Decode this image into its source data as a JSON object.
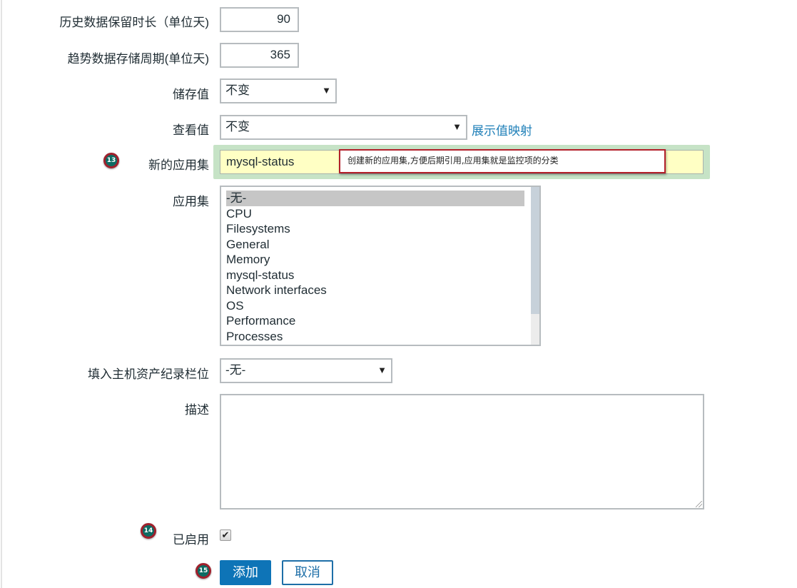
{
  "form": {
    "history": {
      "label": "历史数据保留时长（单位天)",
      "value": "90"
    },
    "trends": {
      "label": "趋势数据存储周期(单位天)",
      "value": "365"
    },
    "store_value": {
      "label": "储存值",
      "selected": "不变"
    },
    "show_value": {
      "label": "查看值",
      "selected": "不变",
      "link": "展示值映射"
    },
    "new_application": {
      "label": "新的应用集",
      "value": "mysql-status",
      "tooltip": "创建新的应用集,方便后期引用,应用集就是监控项的分类"
    },
    "applications": {
      "label": "应用集",
      "options": [
        "-无-",
        "CPU",
        "Filesystems",
        "General",
        "Memory",
        "mysql-status",
        "Network interfaces",
        "OS",
        "Performance",
        "Processes"
      ],
      "selected": "-无-"
    },
    "inventory": {
      "label": "填入主机资产纪录栏位",
      "selected": "-无-"
    },
    "description": {
      "label": "描述",
      "value": ""
    },
    "enabled": {
      "label": "已启用",
      "checked": true,
      "check_glyph": "✔"
    },
    "buttons": {
      "add": "添加",
      "cancel": "取消"
    }
  },
  "annotations": {
    "badge_13": "13",
    "badge_14": "14",
    "badge_15": "15"
  },
  "icons": {
    "dropdown_arrow": "▼"
  },
  "colors": {
    "link": "#1e7fb8",
    "primary_button": "#0e74b7",
    "highlight": "#c6e3c6",
    "input_highlight": "#ffffc4",
    "tooltip_border": "#b3202a",
    "badge": "#0d6b63"
  }
}
